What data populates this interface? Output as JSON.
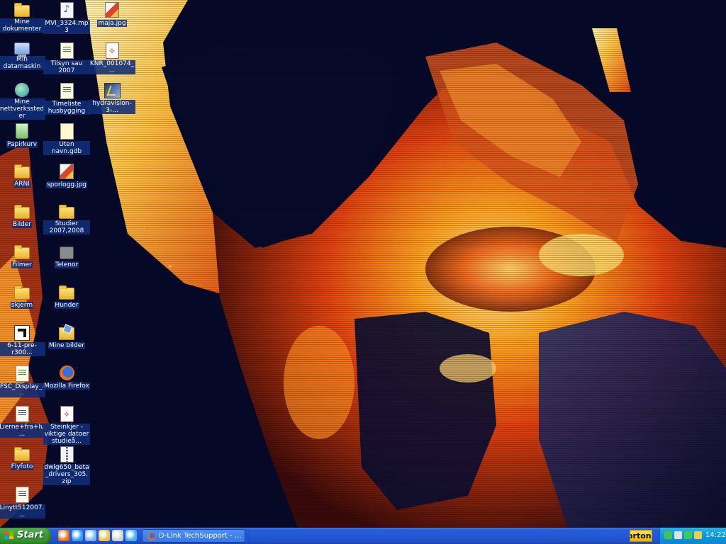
{
  "desktop": {
    "icons": [
      {
        "id": "mine-dokumenter",
        "label": "Mine dokumenter",
        "icon": "folder-documents-icon"
      },
      {
        "id": "min-datamaskin",
        "label": "Min datamaskin",
        "icon": "computer-icon"
      },
      {
        "id": "mine-nettverkssteder",
        "label": "Mine nettverkssteder",
        "icon": "network-icon"
      },
      {
        "id": "papirkurv",
        "label": "Papirkurv",
        "icon": "recycle-bin-icon"
      },
      {
        "id": "arni",
        "label": "ARNI",
        "icon": "folder-icon"
      },
      {
        "id": "bilder",
        "label": "Bilder",
        "icon": "folder-icon"
      },
      {
        "id": "filmer",
        "label": "Filmer",
        "icon": "folder-icon"
      },
      {
        "id": "skjerm",
        "label": "skjerm",
        "icon": "folder-icon"
      },
      {
        "id": "amd-driver",
        "label": "6-11-pre-r300...",
        "icon": "amd-icon"
      },
      {
        "id": "fsc-display",
        "label": "FSC_Display_...",
        "icon": "document-icon"
      },
      {
        "id": "lierne",
        "label": "Lierne+fra+lu...",
        "icon": "word-document-icon"
      },
      {
        "id": "flyfoto",
        "label": "Flyfoto",
        "icon": "folder-icon"
      },
      {
        "id": "linytt",
        "label": "Linytt512007....",
        "icon": "word-document-icon"
      },
      {
        "id": "mvi-mp3",
        "label": "MVI_3324.mp3",
        "icon": "audio-file-icon"
      },
      {
        "id": "tilsyn-sau",
        "label": "Tilsyn sau 2007",
        "icon": "excel-file-icon"
      },
      {
        "id": "timeliste",
        "label": "Timeliste husbygging",
        "icon": "excel-file-icon"
      },
      {
        "id": "uten-navn",
        "label": "Uten navn.gdb",
        "icon": "gdb-file-icon"
      },
      {
        "id": "sporlogg",
        "label": "sporlogg.jpg",
        "icon": "image-file-icon"
      },
      {
        "id": "studier",
        "label": "Studier 2007,2008",
        "icon": "folder-icon"
      },
      {
        "id": "telenor",
        "label": "Telenor",
        "icon": "phone-icon"
      },
      {
        "id": "hunder",
        "label": "Hunder",
        "icon": "folder-icon"
      },
      {
        "id": "mine-bilder",
        "label": "Mine bilder",
        "icon": "folder-pictures-icon"
      },
      {
        "id": "firefox",
        "label": "Mozilla Firefox",
        "icon": "firefox-icon"
      },
      {
        "id": "steinkjer",
        "label": "Steinkjer - viktige datoer studieå...",
        "icon": "pdf-file-icon"
      },
      {
        "id": "dwlg650",
        "label": "dwlg650_beta_drivers_305.zip",
        "icon": "zip-file-icon"
      },
      {
        "id": "maja",
        "label": "maja.jpg",
        "icon": "image-file-icon"
      },
      {
        "id": "knr",
        "label": "KNR_001074_...",
        "icon": "pdf-file-icon"
      },
      {
        "id": "hydravision",
        "label": "hydravision-3-...",
        "icon": "hydravision-icon"
      }
    ]
  },
  "taskbar": {
    "start_label": "Start",
    "quick_launch": [
      {
        "icon": "firefox-icon",
        "color": "#e8701a"
      },
      {
        "icon": "ie-icon",
        "color": "#3a9ae8"
      },
      {
        "icon": "desktop-show-icon",
        "color": "#7ab8f0"
      },
      {
        "icon": "media-icon",
        "color": "#f0c040"
      },
      {
        "icon": "game-icon",
        "color": "#d0d0d0"
      },
      {
        "icon": "internet-explorer-icon",
        "color": "#4ab0f0"
      }
    ],
    "open_window_label": "D-Link TechSupport - ...",
    "norton_label": "orton\"",
    "tray_icons": [
      {
        "icon": "security-icon",
        "color": "#49c24a"
      },
      {
        "icon": "network-icon",
        "color": "#e0e0e0"
      },
      {
        "icon": "antivirus-icon",
        "color": "#46c848"
      },
      {
        "icon": "messenger-icon",
        "color": "#f0d040"
      }
    ],
    "clock": "14:22"
  },
  "colors": {
    "taskbar_blue": "#245edb",
    "start_green": "#3c9a36",
    "tray_blue": "#0f96e0"
  }
}
